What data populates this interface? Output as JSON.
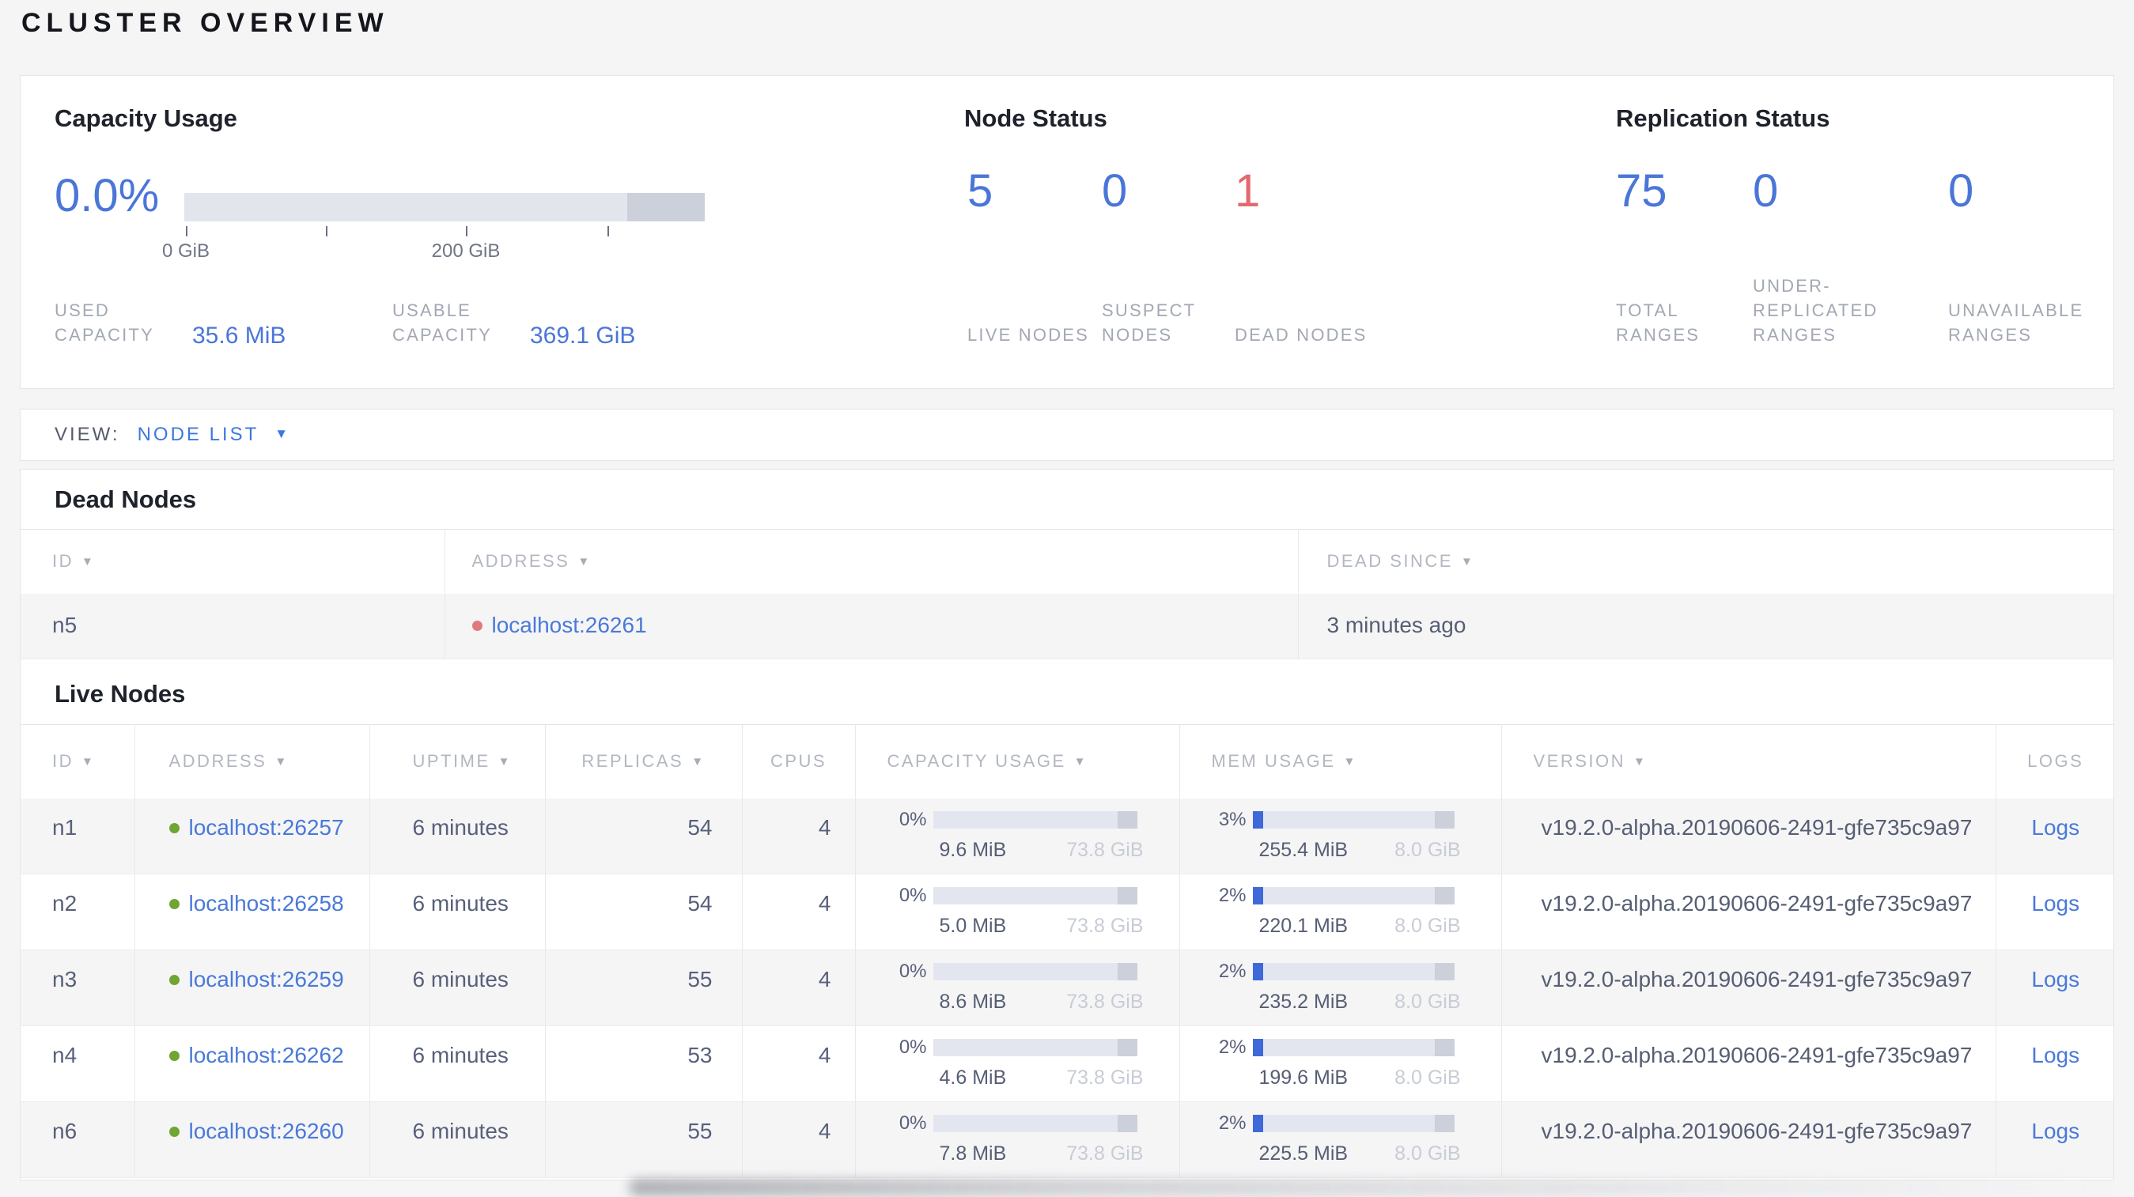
{
  "page": {
    "title": "CLUSTER OVERVIEW"
  },
  "colors": {
    "accent_blue": "#4a76d8",
    "link_blue": "#4a79d9",
    "danger_red": "#e2696f",
    "live_dot_green": "#70a533",
    "dead_dot_red": "#e07980",
    "bar_track": "#e4e6ef",
    "bar_end_cap": "#ccd0da",
    "mem_fill_blue": "#3f68d9"
  },
  "icons": {
    "sort_caret": "▼",
    "dropdown_caret": "▼"
  },
  "summary": {
    "capacity": {
      "title": "Capacity Usage",
      "percent": "0.0%",
      "axis_ticks": [
        "0 GiB",
        "200 GiB"
      ],
      "stats": [
        {
          "label": "USED CAPACITY",
          "value": "35.6 MiB"
        },
        {
          "label": "USABLE CAPACITY",
          "value": "369.1 GiB"
        }
      ]
    },
    "nodes": {
      "title": "Node Status",
      "stats": [
        {
          "value": "5",
          "label": "LIVE NODES"
        },
        {
          "value": "0",
          "label": "SUSPECT NODES"
        },
        {
          "value": "1",
          "label": "DEAD NODES"
        }
      ]
    },
    "replication": {
      "title": "Replication Status",
      "stats": [
        {
          "value": "75",
          "label": "TOTAL RANGES"
        },
        {
          "value": "0",
          "label": "UNDER-REPLICATED RANGES"
        },
        {
          "value": "0",
          "label": "UNAVAILABLE RANGES"
        }
      ]
    }
  },
  "view_bar": {
    "label": "VIEW:",
    "selected": "NODE LIST"
  },
  "dead_nodes": {
    "title": "Dead Nodes",
    "columns": [
      {
        "label": "ID"
      },
      {
        "label": "ADDRESS"
      },
      {
        "label": "DEAD SINCE"
      }
    ],
    "rows": [
      {
        "id": "n5",
        "address": "localhost:26261",
        "dead_since": "3 minutes ago"
      }
    ]
  },
  "live_nodes": {
    "title": "Live Nodes",
    "columns": [
      {
        "label": "ID"
      },
      {
        "label": "ADDRESS"
      },
      {
        "label": "UPTIME"
      },
      {
        "label": "REPLICAS"
      },
      {
        "label": "CPUS"
      },
      {
        "label": "CAPACITY USAGE"
      },
      {
        "label": "MEM USAGE"
      },
      {
        "label": "VERSION"
      },
      {
        "label": "LOGS"
      }
    ],
    "rows": [
      {
        "id": "n1",
        "address": "localhost:26257",
        "uptime": "6 minutes",
        "replicas": "54",
        "cpus": "4",
        "capacity": {
          "percent": "0%",
          "used": "9.6 MiB",
          "total": "73.8 GiB"
        },
        "mem": {
          "percent": "3%",
          "used": "255.4 MiB",
          "total": "8.0 GiB"
        },
        "version": "v19.2.0-alpha.20190606-2491-gfe735c9a97",
        "logs": "Logs"
      },
      {
        "id": "n2",
        "address": "localhost:26258",
        "uptime": "6 minutes",
        "replicas": "54",
        "cpus": "4",
        "capacity": {
          "percent": "0%",
          "used": "5.0 MiB",
          "total": "73.8 GiB"
        },
        "mem": {
          "percent": "2%",
          "used": "220.1 MiB",
          "total": "8.0 GiB"
        },
        "version": "v19.2.0-alpha.20190606-2491-gfe735c9a97",
        "logs": "Logs"
      },
      {
        "id": "n3",
        "address": "localhost:26259",
        "uptime": "6 minutes",
        "replicas": "55",
        "cpus": "4",
        "capacity": {
          "percent": "0%",
          "used": "8.6 MiB",
          "total": "73.8 GiB"
        },
        "mem": {
          "percent": "2%",
          "used": "235.2 MiB",
          "total": "8.0 GiB"
        },
        "version": "v19.2.0-alpha.20190606-2491-gfe735c9a97",
        "logs": "Logs"
      },
      {
        "id": "n4",
        "address": "localhost:26262",
        "uptime": "6 minutes",
        "replicas": "53",
        "cpus": "4",
        "capacity": {
          "percent": "0%",
          "used": "4.6 MiB",
          "total": "73.8 GiB"
        },
        "mem": {
          "percent": "2%",
          "used": "199.6 MiB",
          "total": "8.0 GiB"
        },
        "version": "v19.2.0-alpha.20190606-2491-gfe735c9a97",
        "logs": "Logs"
      },
      {
        "id": "n6",
        "address": "localhost:26260",
        "uptime": "6 minutes",
        "replicas": "55",
        "cpus": "4",
        "capacity": {
          "percent": "0%",
          "used": "7.8 MiB",
          "total": "73.8 GiB"
        },
        "mem": {
          "percent": "2%",
          "used": "225.5 MiB",
          "total": "8.0 GiB"
        },
        "version": "v19.2.0-alpha.20190606-2491-gfe735c9a97",
        "logs": "Logs"
      }
    ]
  }
}
